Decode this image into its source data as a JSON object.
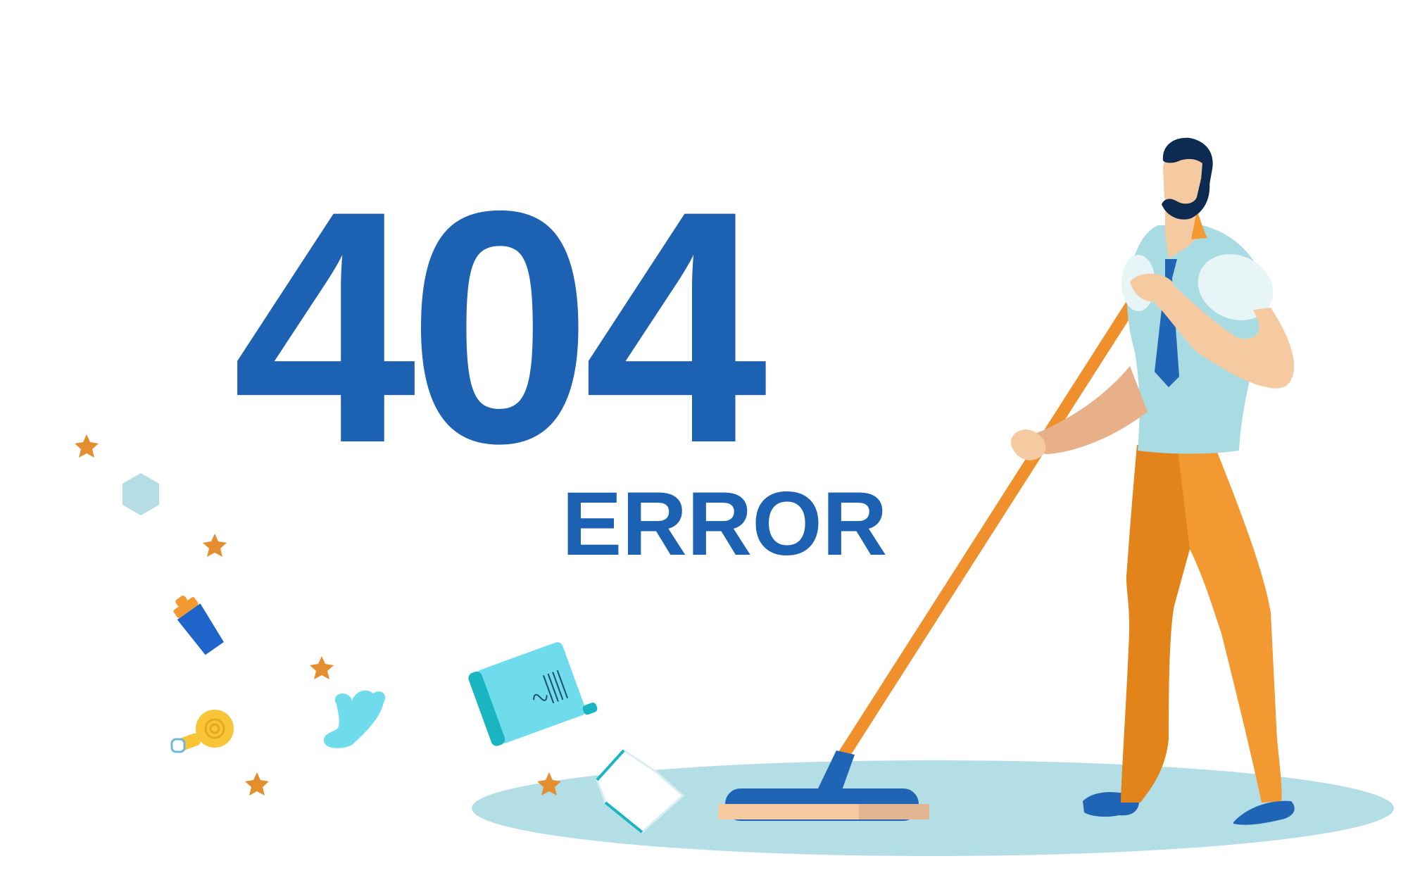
{
  "error": {
    "code": "404",
    "label": "ERROR"
  },
  "colors": {
    "primary_blue": "#1d61b2",
    "floor": "#b4dee6",
    "shirt": "#a9dbe3",
    "pants_light": "#f29a31",
    "pants_dark": "#e3841a",
    "mop_handle": "#f0902c",
    "skin": "#f5caa0",
    "hair": "#0d2b50",
    "shoes": "#1f64b5",
    "stars": "#e48e2f",
    "bulb": "#f7c537",
    "paper": "#6fdcee"
  },
  "illustration": {
    "icons": [
      "man-mopping-icon",
      "mop-icon",
      "floor-puddle-icon",
      "lightbulb-icon",
      "cup-icon",
      "document-icon",
      "paper-sheet-icon",
      "hexagon-icon",
      "splash-icon",
      "star-icon"
    ]
  }
}
